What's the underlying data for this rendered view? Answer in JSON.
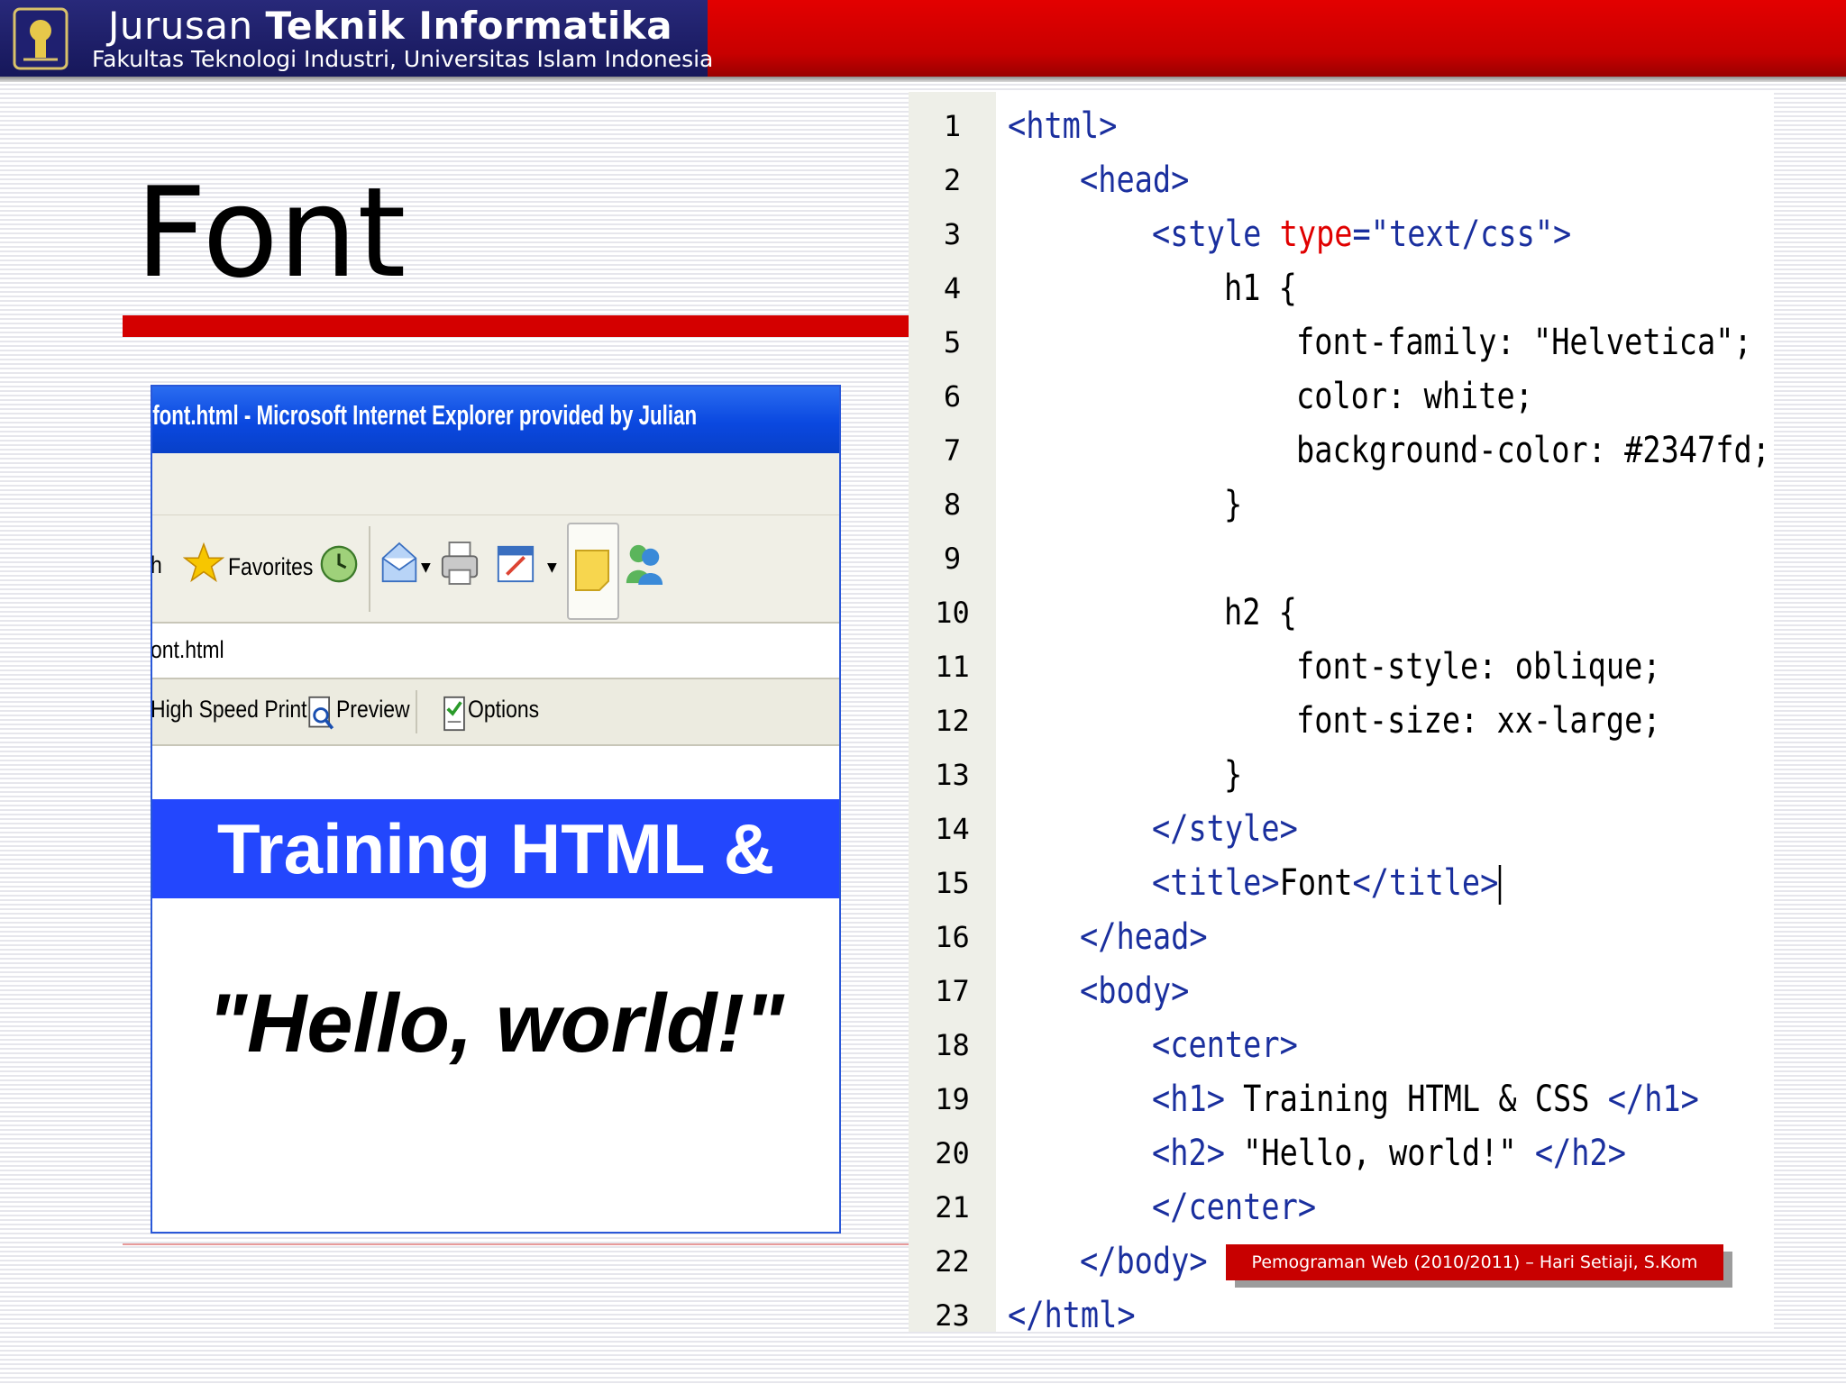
{
  "header": {
    "brand_light": "Jurusan ",
    "brand_bold": "Teknik Informatika",
    "subtitle": "Fakultas Teknologi Industri, Universitas Islam Indonesia"
  },
  "slide": {
    "title": "Font"
  },
  "browser": {
    "window_title": ".font.html - Microsoft Internet Explorer provided by Julian",
    "toolbar": {
      "search_partial": "h",
      "favorites_label": "Favorites"
    },
    "address_value": "ont.html",
    "links_bar": {
      "high_speed_print_label": "High Speed Print",
      "preview_label": "Preview",
      "options_label": "Options"
    },
    "page": {
      "h1": "Training HTML & CSS",
      "h2": "\"Hello, world!\"",
      "h1_background": "#2347fd"
    }
  },
  "code_editor": {
    "line_numbers": [
      "1",
      "2",
      "3",
      "4",
      "5",
      "6",
      "7",
      "8",
      "9",
      "10",
      "11",
      "12",
      "13",
      "14",
      "15",
      "16",
      "17",
      "18",
      "19",
      "20",
      "21",
      "22",
      "23"
    ],
    "lines": [
      "<html>",
      "<head>",
      "<style type=\"text/css\">",
      "h1 {",
      "font-family: \"Helvetica\";",
      "color: white;",
      "background-color: #2347fd;",
      "}",
      "",
      "h2 {",
      "font-style: oblique;",
      "font-size: xx-large;",
      "}",
      "</style>",
      "<title>Font</title>",
      "</head>",
      "<body>",
      "<center>",
      "<h1> Training HTML & CSS </h1>",
      "<h2> \"Hello, world!\" </h2>",
      "</center>",
      "</body>",
      "</html>"
    ]
  },
  "footer": {
    "text": "Pemograman Web (2010/2011) – Hari Setiaji, S.Kom"
  },
  "colors": {
    "header_red": "#d40000",
    "brand_navy": "#1f2070",
    "code_tag_blue": "#1a2f9e",
    "code_attr_red": "#e00000"
  }
}
